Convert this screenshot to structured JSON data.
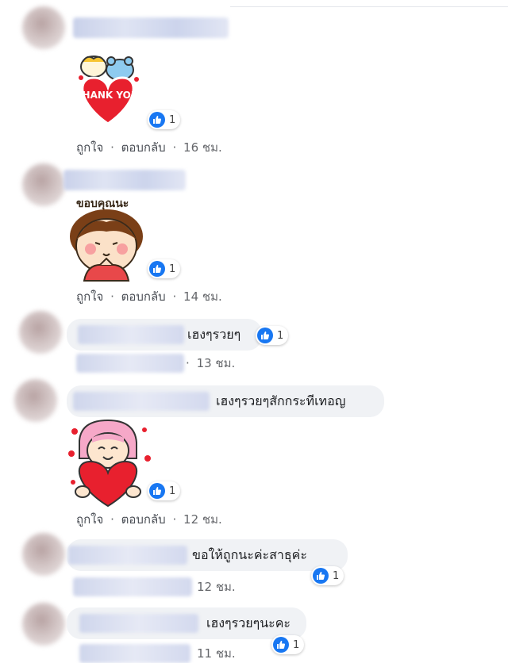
{
  "comments": [
    {
      "type": "sticker",
      "sticker_text": "THANK YOU",
      "reaction_count": "1",
      "actions": {
        "like": "ถูกใจ",
        "reply": "ตอบกลับ",
        "time": "16 ชม."
      }
    },
    {
      "type": "sticker",
      "sticker_text": "ขอบคุณนะ",
      "reaction_count": "1",
      "actions": {
        "like": "ถูกใจ",
        "reply": "ตอบกลับ",
        "time": "14 ชม."
      }
    },
    {
      "type": "text",
      "text": "เฮงๆรวยๆ",
      "reaction_count": "1",
      "actions": {
        "time": "13 ชม."
      }
    },
    {
      "type": "text",
      "text": "เฮงๆรวยๆสักกระทีเทอญ",
      "reaction_count": "",
      "actions": {}
    },
    {
      "type": "sticker",
      "sticker_text": "",
      "reaction_count": "1",
      "actions": {
        "like": "ถูกใจ",
        "reply": "ตอบกลับ",
        "time": "12 ชม."
      }
    },
    {
      "type": "text",
      "text": "ขอให้ถูกนะค่ะสาธุค่ะ",
      "reaction_count": "1",
      "actions": {
        "time": "12 ชม."
      }
    },
    {
      "type": "text",
      "text": "เฮงๆรวยๆนะคะ",
      "reaction_count": "1",
      "actions": {
        "time": "11 ชม."
      }
    }
  ],
  "separator": "·",
  "colors": {
    "like_blue": "#1877f2",
    "bubble_bg": "#f0f2f5",
    "meta_text": "#65676b"
  },
  "icons": {
    "like": "thumbs-up-icon"
  }
}
